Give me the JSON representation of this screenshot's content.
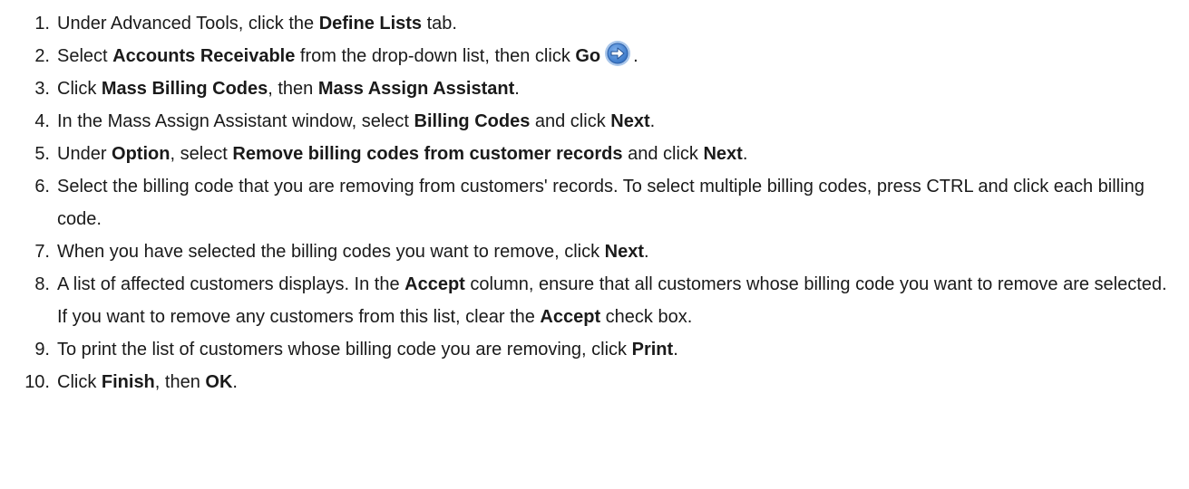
{
  "steps": [
    {
      "num": "1.",
      "parts": [
        {
          "t": "Under Advanced Tools, click the ",
          "b": false
        },
        {
          "t": "Define Lists",
          "b": true
        },
        {
          "t": " tab.",
          "b": false
        }
      ]
    },
    {
      "num": "2.",
      "parts": [
        {
          "t": "Select ",
          "b": false
        },
        {
          "t": "Accounts Receivable",
          "b": true
        },
        {
          "t": " from the drop-down list, then click ",
          "b": false
        },
        {
          "t": "Go",
          "b": true
        },
        {
          "icon": "go-arrow-icon"
        },
        {
          "t": ".",
          "b": false
        }
      ]
    },
    {
      "num": "3.",
      "parts": [
        {
          "t": "Click ",
          "b": false
        },
        {
          "t": "Mass Billing Codes",
          "b": true
        },
        {
          "t": ", then ",
          "b": false
        },
        {
          "t": "Mass Assign Assistant",
          "b": true
        },
        {
          "t": ".",
          "b": false
        }
      ]
    },
    {
      "num": "4.",
      "parts": [
        {
          "t": "In the Mass Assign Assistant window, select ",
          "b": false
        },
        {
          "t": "Billing Codes",
          "b": true
        },
        {
          "t": " and click ",
          "b": false
        },
        {
          "t": "Next",
          "b": true
        },
        {
          "t": ".",
          "b": false
        }
      ]
    },
    {
      "num": "5.",
      "parts": [
        {
          "t": "Under ",
          "b": false
        },
        {
          "t": "Option",
          "b": true
        },
        {
          "t": ", select ",
          "b": false
        },
        {
          "t": "Remove billing codes from customer records",
          "b": true
        },
        {
          "t": " and click ",
          "b": false
        },
        {
          "t": "Next",
          "b": true
        },
        {
          "t": ".",
          "b": false
        }
      ]
    },
    {
      "num": "6.",
      "parts": [
        {
          "t": "Select the billing code that you are removing from customers' records. To select multiple billing codes, press CTRL and click each billing code.",
          "b": false
        }
      ]
    },
    {
      "num": "7.",
      "parts": [
        {
          "t": "When you have selected the billing codes you want to remove, click ",
          "b": false
        },
        {
          "t": "Next",
          "b": true
        },
        {
          "t": ".",
          "b": false
        }
      ]
    },
    {
      "num": "8.",
      "parts": [
        {
          "t": "A list of affected customers displays. In the ",
          "b": false
        },
        {
          "t": "Accept",
          "b": true
        },
        {
          "t": " column, ensure that all customers whose billing code you want to remove are selected. If you want to remove any customers from this list, clear the ",
          "b": false
        },
        {
          "t": "Accept",
          "b": true
        },
        {
          "t": " check box.",
          "b": false
        }
      ]
    },
    {
      "num": "9.",
      "parts": [
        {
          "t": "To print the list of customers whose billing code you are removing, click ",
          "b": false
        },
        {
          "t": "Print",
          "b": true
        },
        {
          "t": ".",
          "b": false
        }
      ]
    },
    {
      "num": "10.",
      "parts": [
        {
          "t": "Click ",
          "b": false
        },
        {
          "t": "Finish",
          "b": true
        },
        {
          "t": ", then ",
          "b": false
        },
        {
          "t": "OK",
          "b": true
        },
        {
          "t": ".",
          "b": false
        }
      ]
    }
  ],
  "colors": {
    "text": "#1a1a1a",
    "go_icon_fill": "#3a78c8",
    "go_icon_ring": "#a9c6ea"
  }
}
